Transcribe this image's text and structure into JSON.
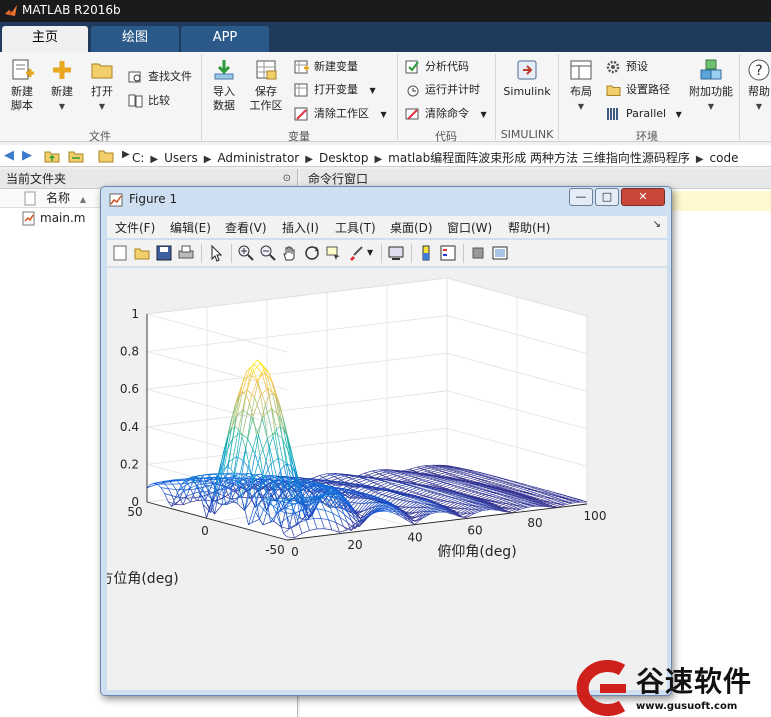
{
  "app": {
    "title": "MATLAB R2016b"
  },
  "tabs": [
    {
      "label": "主页"
    },
    {
      "label": "绘图"
    },
    {
      "label": "APP"
    }
  ],
  "ribbon": {
    "file_group": {
      "label": "文件",
      "new_script": "新建\n脚本",
      "new": "新建",
      "open": "打开",
      "find_files": "查找文件",
      "compare": "比较"
    },
    "variable_group": {
      "label": "变量",
      "import": "导入\n数据",
      "save_ws": "保存\n工作区",
      "new_var": "新建变量",
      "open_var": "打开变量",
      "clear_ws": "清除工作区"
    },
    "code_group": {
      "label": "代码",
      "analyze": "分析代码",
      "run_timing": "运行并计时",
      "clear_cmds": "清除命令"
    },
    "simulink_group": {
      "label": "SIMULINK",
      "simulink": "Simulink"
    },
    "env_group": {
      "label": "环境",
      "layout": "布局",
      "prefs": "预设",
      "set_path": "设置路径",
      "parallel": "Parallel",
      "addons": "附加功能",
      "help": "帮助"
    }
  },
  "address": {
    "crumbs": [
      "C:",
      "Users",
      "Administrator",
      "Desktop",
      "matlab编程面阵波束形成 两种方法 三维指向性源码程序",
      "code"
    ]
  },
  "left_pane": {
    "title": "当前文件夹",
    "col_name": "名称",
    "sort_arrow": "▲",
    "files": [
      {
        "name": "main.m"
      }
    ]
  },
  "right_pane": {
    "title": "命令行窗口"
  },
  "figure": {
    "title": "Figure 1",
    "menus": [
      "文件(F)",
      "编辑(E)",
      "查看(V)",
      "插入(I)",
      "工具(T)",
      "桌面(D)",
      "窗口(W)",
      "帮助(H)"
    ],
    "min": "—",
    "max": "□",
    "close": "✕"
  },
  "chart_data": {
    "type": "surface",
    "title": "",
    "xlabel": "俯仰角(deg)",
    "ylabel": "方位角(deg)",
    "zlabel": "",
    "x_ticks": [
      0,
      20,
      40,
      60,
      80,
      100
    ],
    "y_ticks": [
      -50,
      0,
      50
    ],
    "z_ticks": [
      "0",
      "0.2",
      "0.4",
      "0.6",
      "0.8",
      "1"
    ],
    "xlim": [
      0,
      100
    ],
    "ylim": [
      -50,
      50
    ],
    "zlim": [
      0,
      1
    ],
    "peak": {
      "x": 10,
      "y": -8,
      "z": 0.87
    },
    "colormap": "parula",
    "grid": true,
    "style": "mesh"
  },
  "watermark": {
    "brand": "谷速软件",
    "url": "www.gusuoft.com"
  },
  "colors": {
    "titlebar": "#1b1b1b",
    "tabbar": "#1e3a5c",
    "accent": "#d0201c"
  }
}
